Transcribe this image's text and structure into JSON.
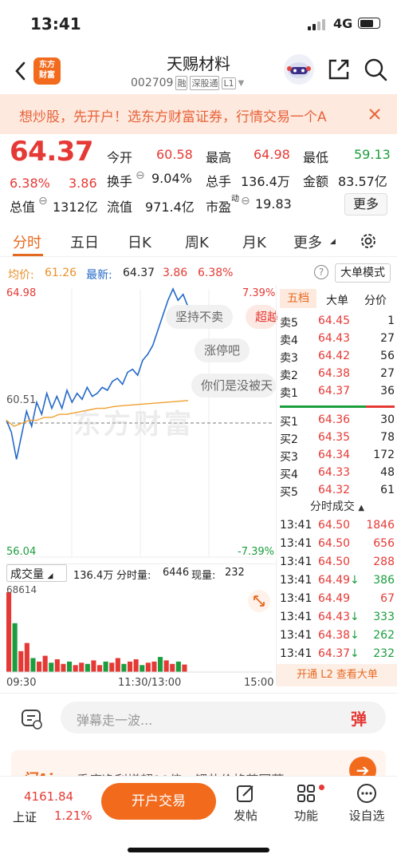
{
  "status_bar": {
    "time": "13:41",
    "network": "4G"
  },
  "header": {
    "title": "天赐材料",
    "code": "002709",
    "tags": [
      "融",
      "深股通",
      "L1"
    ]
  },
  "banner": {
    "text": "想炒股，先开户！选东方财富证券，行情交易一个A"
  },
  "quote": {
    "price": "64.37",
    "change_pct": "6.38%",
    "change": "3.86",
    "open_label": "今开",
    "open": "60.58",
    "high_label": "最高",
    "high": "64.98",
    "low_label": "最低",
    "low": "59.13",
    "turnover_label": "换手",
    "turnover": "9.04%",
    "volume_label": "总手",
    "volume": "136.4万",
    "amount_label": "金额",
    "amount": "83.57亿",
    "mktcap_label": "总值",
    "mktcap": "1312亿",
    "float_label": "流值",
    "float": "971.4亿",
    "pe_label": "市盈",
    "pe_sup": "动",
    "pe": "19.83",
    "more_button": "更多"
  },
  "tabs": [
    "分时",
    "五日",
    "日K",
    "周K",
    "月K",
    "更多"
  ],
  "subbar": {
    "avg_label": "均价:",
    "avg": "61.26",
    "last_label": "最新:",
    "last": "64.37",
    "chg": "3.86",
    "pct": "6.38%",
    "help": "?",
    "bigorder_button": "大单模式"
  },
  "chart": {
    "y_top": "64.98",
    "y_mid": "60.51",
    "y_bottom": "56.04",
    "pct_top": "7.39%",
    "pct_bottom": "-7.39%",
    "vol_label": "成交量",
    "vol_total": "136.4万",
    "vol_period_label": "分时量:",
    "vol_period": "6446",
    "vol_now_label": "现量:",
    "vol_now": "232",
    "vol_max": "68614",
    "x_labels": [
      "09:30",
      "11:30/13:00",
      "15:00"
    ],
    "watermark": "东方财富",
    "bubbles": [
      "坚持不卖",
      "超越",
      "涨停吧",
      "你们是没被天"
    ]
  },
  "chart_data": {
    "type": "line",
    "series": [
      {
        "values": [
          60.6,
          60.2,
          59.3,
          60.1,
          60.9,
          60.4,
          61.2,
          60.8,
          61.5,
          61.0,
          61.4,
          61.0,
          61.6,
          61.2,
          61.5,
          61.3,
          61.7,
          61.4,
          61.5,
          61.7,
          61.6,
          61.9,
          62.0,
          61.8,
          62.2,
          62.3,
          62.1,
          62.6,
          62.8,
          63.1,
          63.6,
          64.1,
          64.6,
          64.98,
          64.6,
          64.8,
          64.37
        ]
      },
      {
        "values": [
          60.6,
          60.4,
          60.5,
          60.6,
          60.6,
          60.7,
          60.7,
          60.8,
          60.8,
          60.85,
          60.9,
          60.95,
          61.0,
          61.0,
          61.05,
          61.08,
          61.1,
          61.12,
          61.14,
          61.16,
          61.18,
          61.2,
          61.22,
          61.24,
          61.26
        ]
      }
    ],
    "ylim": [
      56.04,
      64.98
    ],
    "volumes": [
      68614,
      42000,
      18000,
      25000,
      12000,
      9000,
      14000,
      8000,
      11000,
      7000,
      9000,
      6000,
      8000,
      7000,
      10000,
      6000,
      9000,
      8000,
      12000,
      7000,
      9000,
      11000,
      6000,
      8000,
      9000,
      13000,
      10000,
      7000,
      9000,
      6446
    ]
  },
  "orderbook": {
    "tabs": [
      "五档",
      "大单",
      "分价"
    ],
    "asks": [
      {
        "label": "卖5",
        "price": "64.45",
        "vol": "1"
      },
      {
        "label": "卖4",
        "price": "64.43",
        "vol": "27"
      },
      {
        "label": "卖3",
        "price": "64.42",
        "vol": "56"
      },
      {
        "label": "卖2",
        "price": "64.38",
        "vol": "27"
      },
      {
        "label": "卖1",
        "price": "64.37",
        "vol": "36"
      }
    ],
    "bids": [
      {
        "label": "买1",
        "price": "64.36",
        "vol": "30"
      },
      {
        "label": "买2",
        "price": "64.35",
        "vol": "78"
      },
      {
        "label": "买3",
        "price": "64.34",
        "vol": "172"
      },
      {
        "label": "买4",
        "price": "64.33",
        "vol": "48"
      },
      {
        "label": "买5",
        "price": "64.32",
        "vol": "61"
      }
    ],
    "trades_title": "分时成交",
    "trades": [
      {
        "time": "13:41",
        "price": "64.50",
        "vol": "1846",
        "dir": ""
      },
      {
        "time": "13:41",
        "price": "64.50",
        "vol": "656",
        "dir": ""
      },
      {
        "time": "13:41",
        "price": "64.50",
        "vol": "288",
        "dir": ""
      },
      {
        "time": "13:41",
        "price": "64.49",
        "vol": "386",
        "dir": "↓"
      },
      {
        "time": "13:41",
        "price": "64.49",
        "vol": "67",
        "dir": ""
      },
      {
        "time": "13:41",
        "price": "64.43",
        "vol": "333",
        "dir": "↓"
      },
      {
        "time": "13:41",
        "price": "64.38",
        "vol": "262",
        "dir": "↓"
      },
      {
        "time": "13:41",
        "price": "64.37",
        "vol": "232",
        "dir": "↓"
      }
    ],
    "l2_link": "开通 L2 查看大单"
  },
  "comment": {
    "placeholder": "弹幕走一波...",
    "danmu": "弹"
  },
  "promo": {
    "text": "一季度净利增超10倍，锂盐价格若回落"
  },
  "bottom_nav": {
    "index_value": "4161.84",
    "index_name": "上证",
    "index_pct": "1.21%",
    "trade_button": "开户交易",
    "items": [
      "发帖",
      "功能",
      "设自选"
    ]
  }
}
